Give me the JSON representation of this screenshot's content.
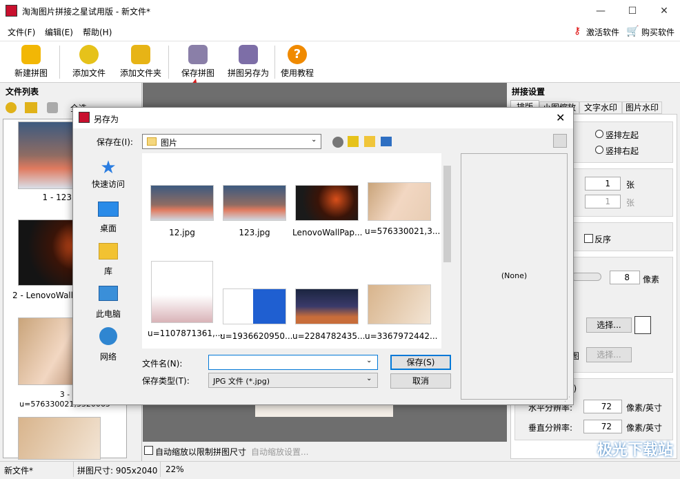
{
  "app": {
    "title": "淘淘图片拼接之星试用版 - 新文件*",
    "logo_text": "图片拼接"
  },
  "window_controls": {
    "minimize": "—",
    "maximize": "☐",
    "close": "✕"
  },
  "menu": {
    "items": [
      "文件(F)",
      "编辑(E)",
      "帮助(H)"
    ],
    "activate": "激活软件",
    "buy": "购买软件"
  },
  "toolbar": {
    "buttons": [
      {
        "label": "新建拼图",
        "icon": "new-mosaic-icon",
        "color": "#f2b705"
      },
      {
        "label": "添加文件",
        "icon": "add-file-icon",
        "color": "#e6c21a"
      },
      {
        "label": "添加文件夹",
        "icon": "add-folder-icon",
        "color": "#e7b416"
      },
      {
        "label": "保存拼图",
        "icon": "save-mosaic-icon",
        "color": "#8a7fa8"
      },
      {
        "label": "拼图另存为",
        "icon": "save-as-icon",
        "color": "#7d6ea7"
      },
      {
        "label": "使用教程",
        "icon": "help-icon",
        "color": "#f08a00"
      }
    ]
  },
  "left_panel": {
    "title": "文件列表",
    "select_all": "全选",
    "files": [
      "1 - 123.jpg",
      "2 - LenovoWallP",
      "3 -\nu=576330021,3320065"
    ]
  },
  "right_panel": {
    "title": "拼接设置",
    "tabs": [
      "排版",
      "小图缩放",
      "文字水印",
      "图片水印"
    ],
    "radio_left": "竖排左起",
    "radio_right": "竖排右起",
    "count1": "1",
    "count2": "1",
    "unit_zhang": "张",
    "reverse": "反序",
    "spacing": "8",
    "unit_px": "像素",
    "select_btn": "选择...",
    "select_btn2": "选择...",
    "partial_label": "图",
    "dpi_group_suffix": "I)",
    "h_dpi_label": "水平分辨率:",
    "v_dpi_label": "垂直分辨率:",
    "h_dpi": "72",
    "v_dpi": "72",
    "dpi_unit": "像素/英寸"
  },
  "center": {
    "auto_scale": "自动缩放以限制拼图尺寸",
    "auto_scale_settings": "自动缩放设置..."
  },
  "statusbar": {
    "file": "新文件*",
    "size": "拼图尺寸: 905x2040",
    "zoom": "22%"
  },
  "dialog": {
    "title": "另存为",
    "save_in_label": "保存在(I):",
    "folder": "图片",
    "places": [
      "快速访问",
      "桌面",
      "库",
      "此电脑",
      "网络"
    ],
    "files": [
      {
        "name": "12.jpg",
        "colors": [
          "#3d5a80",
          "#e07a5f"
        ]
      },
      {
        "name": "123.jpg",
        "colors": [
          "#3d5a80",
          "#e07a5f"
        ]
      },
      {
        "name": "LenovoWallPap...",
        "colors": [
          "#1a1a1a",
          "#d94f1a"
        ]
      },
      {
        "name": "u=576330021,3...",
        "colors": [
          "#f2d7c2",
          "#c9a47a"
        ]
      },
      {
        "name": "u=1107871361,...",
        "colors": [
          "#ffffff",
          "#d9b3b8"
        ]
      },
      {
        "name": "u=1936620950...",
        "colors": [
          "#1f5fd1",
          "#ffffff"
        ]
      },
      {
        "name": "u=2284782435...",
        "colors": [
          "#1b2540",
          "#c86d3a"
        ]
      },
      {
        "name": "u=3367972442...",
        "colors": [
          "#d8b48c",
          "#f3e5d5"
        ]
      }
    ],
    "filename_label": "文件名(N):",
    "filename_value": "",
    "filetype_label": "保存类型(T):",
    "filetype_value": "JPG 文件 (*.jpg)",
    "save_btn": "保存(S)",
    "cancel_btn": "取消",
    "preview": "(None)"
  },
  "watermark": "极光下载站"
}
